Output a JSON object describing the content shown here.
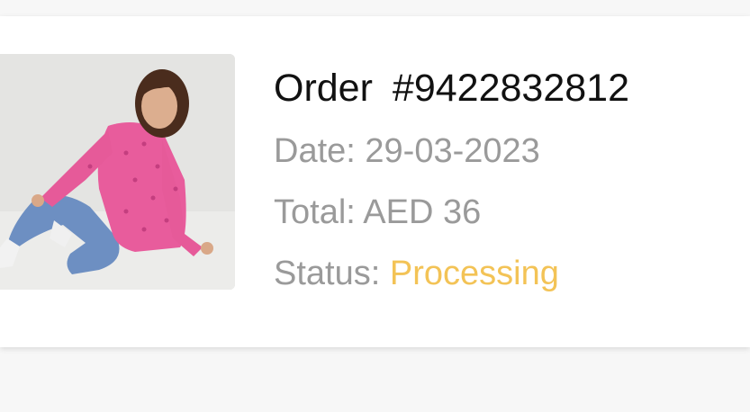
{
  "order": {
    "label": "Order",
    "number": "#9422832812",
    "image": "product-photo"
  },
  "details": {
    "date_label": "Date:",
    "date_value": "29-03-2023",
    "total_label": "Total:",
    "total_value": "AED 36",
    "status_label": "Status:",
    "status_value": "Processing"
  },
  "colors": {
    "status_processing": "#f3c356",
    "meta_text": "#9a9a9a",
    "title_text": "#111111"
  }
}
